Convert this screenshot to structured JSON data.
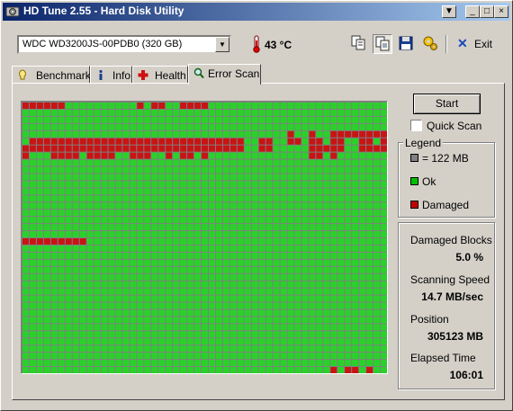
{
  "window": {
    "title": "HD Tune 2.55 - Hard Disk Utility",
    "controls": {
      "down_icon": "arrow-down-icon",
      "minimize": "_",
      "maximize": "□",
      "close": "×"
    }
  },
  "toolbar": {
    "drive_value": "WDC WD3200JS-00PDB0 (320 GB)",
    "temperature": "43 °C",
    "exit_label": "Exit",
    "buttons": [
      "copy-text-icon",
      "copy-screenshot-icon",
      "save-icon",
      "options-icon"
    ]
  },
  "tabs": [
    {
      "label": "Benchmark",
      "icon": "benchmark-icon"
    },
    {
      "label": "Info",
      "icon": "info-icon"
    },
    {
      "label": "Health",
      "icon": "health-icon"
    },
    {
      "label": "Error Scan",
      "icon": "search-icon",
      "active": true
    }
  ],
  "scan": {
    "start_label": "Start",
    "quick_scan_label": "Quick Scan",
    "quick_scan_checked": false
  },
  "legend": {
    "title": "Legend",
    "items": [
      {
        "label": "= 122 MB",
        "color": "#808080"
      },
      {
        "label": "Ok",
        "color": "#00c000"
      },
      {
        "label": "Damaged",
        "color": "#c00000"
      }
    ]
  },
  "stats": {
    "damaged_blocks_label": "Damaged Blocks",
    "damaged_blocks_value": "5.0 %",
    "scanning_speed_label": "Scanning Speed",
    "scanning_speed_value": "14.7 MB/sec",
    "position_label": "Position",
    "position_value": "305123 MB",
    "elapsed_label": "Elapsed Time",
    "elapsed_value": "106:01"
  },
  "grid": {
    "cols": 51,
    "rows": 38,
    "ok_color": "#29d229",
    "damaged_color": "#c81414",
    "damaged_cells": [
      [
        0,
        0
      ],
      [
        0,
        1
      ],
      [
        0,
        2
      ],
      [
        0,
        3
      ],
      [
        0,
        4
      ],
      [
        0,
        5
      ],
      [
        0,
        16
      ],
      [
        0,
        18
      ],
      [
        0,
        19
      ],
      [
        0,
        22
      ],
      [
        0,
        23
      ],
      [
        0,
        24
      ],
      [
        0,
        25
      ],
      [
        4,
        37
      ],
      [
        4,
        40
      ],
      [
        4,
        43
      ],
      [
        4,
        44
      ],
      [
        4,
        45
      ],
      [
        4,
        46
      ],
      [
        4,
        47
      ],
      [
        4,
        48
      ],
      [
        4,
        49
      ],
      [
        4,
        50
      ],
      [
        5,
        1
      ],
      [
        5,
        2
      ],
      [
        5,
        3
      ],
      [
        5,
        4
      ],
      [
        5,
        5
      ],
      [
        5,
        6
      ],
      [
        5,
        7
      ],
      [
        5,
        8
      ],
      [
        5,
        9
      ],
      [
        5,
        10
      ],
      [
        5,
        11
      ],
      [
        5,
        12
      ],
      [
        5,
        13
      ],
      [
        5,
        14
      ],
      [
        5,
        15
      ],
      [
        5,
        16
      ],
      [
        5,
        17
      ],
      [
        5,
        18
      ],
      [
        5,
        19
      ],
      [
        5,
        20
      ],
      [
        5,
        21
      ],
      [
        5,
        22
      ],
      [
        5,
        23
      ],
      [
        5,
        24
      ],
      [
        5,
        25
      ],
      [
        5,
        26
      ],
      [
        5,
        27
      ],
      [
        5,
        28
      ],
      [
        5,
        29
      ],
      [
        5,
        30
      ],
      [
        5,
        33
      ],
      [
        5,
        34
      ],
      [
        5,
        37
      ],
      [
        5,
        38
      ],
      [
        5,
        40
      ],
      [
        5,
        41
      ],
      [
        5,
        43
      ],
      [
        5,
        44
      ],
      [
        5,
        47
      ],
      [
        5,
        48
      ],
      [
        5,
        50
      ],
      [
        6,
        0
      ],
      [
        6,
        1
      ],
      [
        6,
        2
      ],
      [
        6,
        3
      ],
      [
        6,
        4
      ],
      [
        6,
        5
      ],
      [
        6,
        6
      ],
      [
        6,
        7
      ],
      [
        6,
        8
      ],
      [
        6,
        9
      ],
      [
        6,
        10
      ],
      [
        6,
        11
      ],
      [
        6,
        12
      ],
      [
        6,
        13
      ],
      [
        6,
        14
      ],
      [
        6,
        15
      ],
      [
        6,
        16
      ],
      [
        6,
        17
      ],
      [
        6,
        18
      ],
      [
        6,
        19
      ],
      [
        6,
        20
      ],
      [
        6,
        21
      ],
      [
        6,
        22
      ],
      [
        6,
        23
      ],
      [
        6,
        24
      ],
      [
        6,
        25
      ],
      [
        6,
        26
      ],
      [
        6,
        27
      ],
      [
        6,
        28
      ],
      [
        6,
        29
      ],
      [
        6,
        30
      ],
      [
        6,
        33
      ],
      [
        6,
        34
      ],
      [
        6,
        40
      ],
      [
        6,
        41
      ],
      [
        6,
        42
      ],
      [
        6,
        43
      ],
      [
        6,
        44
      ],
      [
        6,
        47
      ],
      [
        6,
        48
      ],
      [
        6,
        49
      ],
      [
        6,
        50
      ],
      [
        7,
        0
      ],
      [
        7,
        4
      ],
      [
        7,
        5
      ],
      [
        7,
        6
      ],
      [
        7,
        7
      ],
      [
        7,
        9
      ],
      [
        7,
        10
      ],
      [
        7,
        11
      ],
      [
        7,
        12
      ],
      [
        7,
        15
      ],
      [
        7,
        16
      ],
      [
        7,
        17
      ],
      [
        7,
        20
      ],
      [
        7,
        22
      ],
      [
        7,
        23
      ],
      [
        7,
        25
      ],
      [
        7,
        40
      ],
      [
        7,
        41
      ],
      [
        7,
        43
      ],
      [
        19,
        0
      ],
      [
        19,
        1
      ],
      [
        19,
        2
      ],
      [
        19,
        3
      ],
      [
        19,
        4
      ],
      [
        19,
        5
      ],
      [
        19,
        6
      ],
      [
        19,
        7
      ],
      [
        19,
        8
      ],
      [
        37,
        43
      ],
      [
        37,
        45
      ],
      [
        37,
        46
      ],
      [
        37,
        48
      ]
    ]
  }
}
